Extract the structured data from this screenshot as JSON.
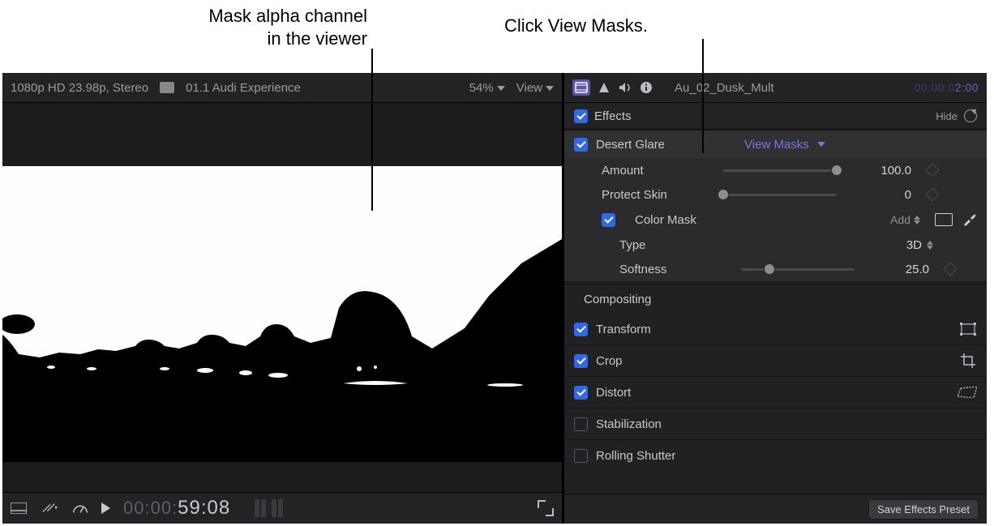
{
  "callouts": {
    "left_line1": "Mask alpha channel",
    "left_line2": "in the viewer",
    "right": "Click View Masks."
  },
  "viewer": {
    "format": "1080p HD 23.98p, Stereo",
    "project": "01.1 Audi Experience",
    "zoom": "54%",
    "view_menu": "View",
    "timecode_dim": "00:00:",
    "timecode_main": "59:08"
  },
  "inspector": {
    "clipname": "Au_02_Dusk_Mult",
    "clip_tc_dim": "00:00:0",
    "clip_tc_main": "2:00",
    "effects_title": "Effects",
    "hide_label": "Hide",
    "effect": {
      "name": "Desert Glare",
      "view_masks": "View Masks",
      "amount": {
        "label": "Amount",
        "value": "100.0",
        "pct": 100
      },
      "protect_skin": {
        "label": "Protect Skin",
        "value": "0",
        "pct": 0
      },
      "color_mask": {
        "label": "Color Mask",
        "add": "Add",
        "type_label": "Type",
        "type_value": "3D",
        "softness_label": "Softness",
        "softness_value": "25.0",
        "softness_pct": 25
      }
    },
    "compositing": "Compositing",
    "transform": "Transform",
    "crop": "Crop",
    "distort": "Distort",
    "stabilization": "Stabilization",
    "rolling_shutter": "Rolling Shutter",
    "save_preset": "Save Effects Preset"
  }
}
